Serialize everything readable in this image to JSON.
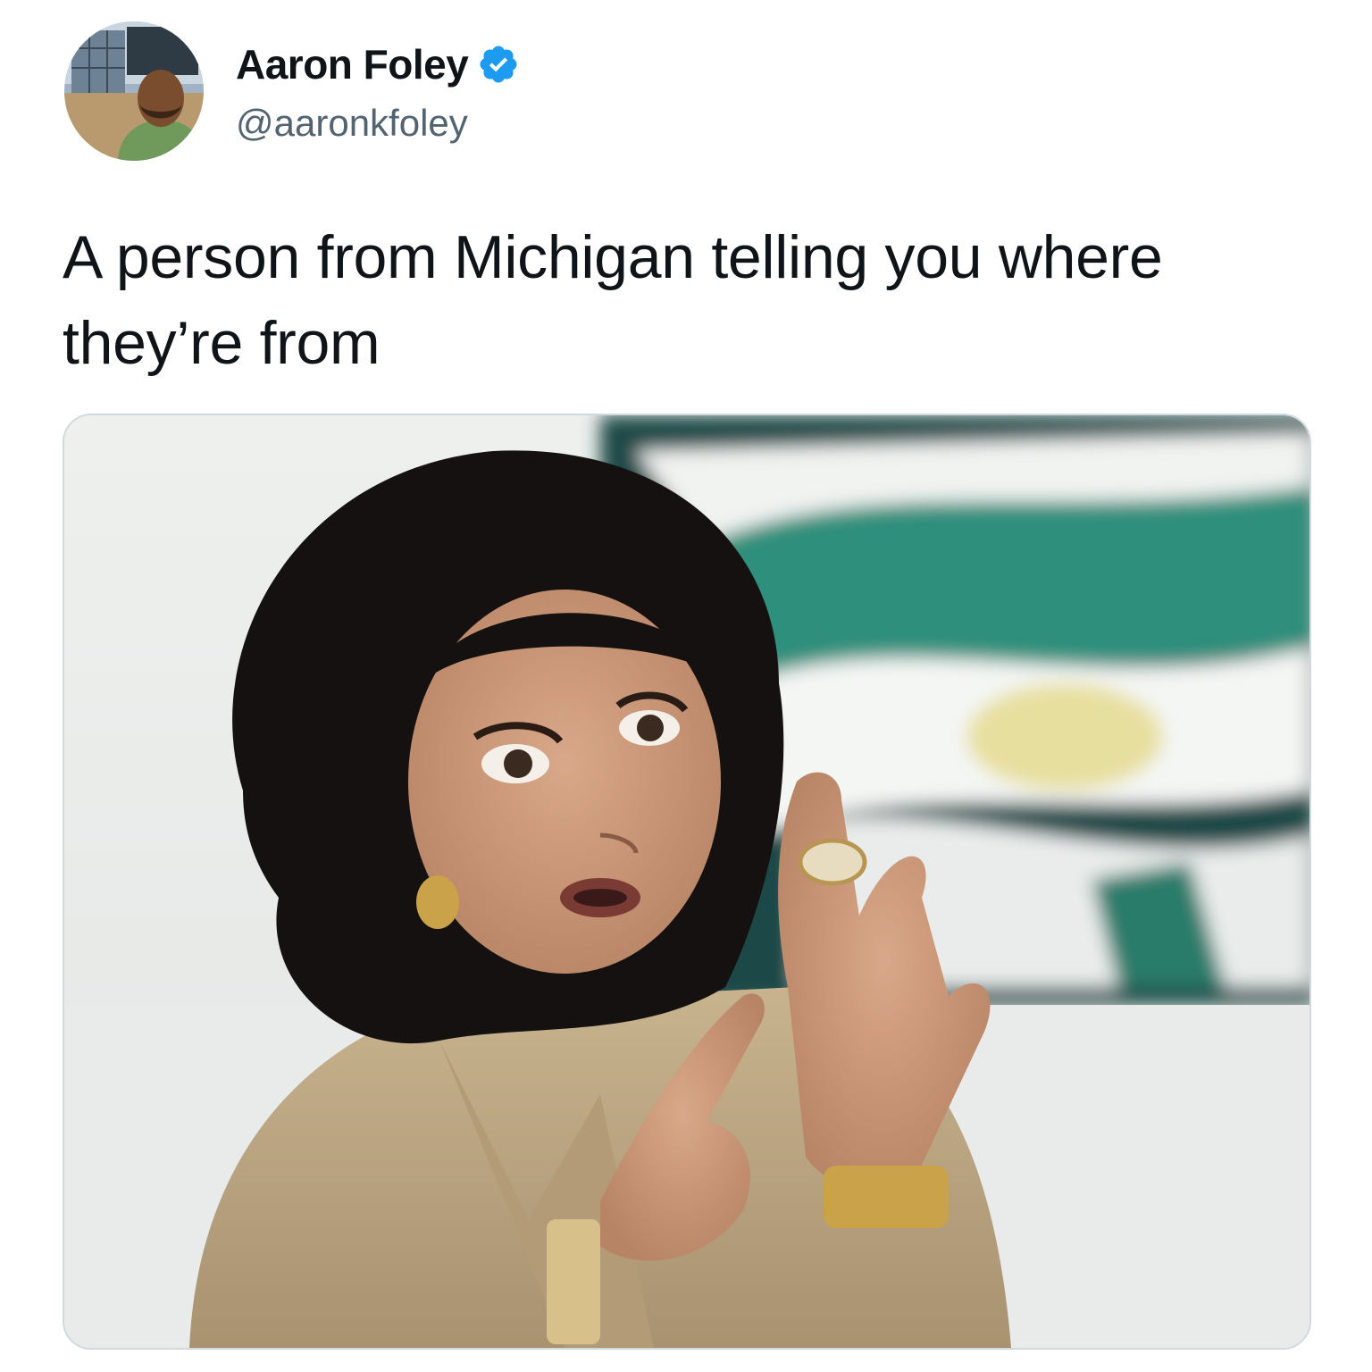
{
  "tweet": {
    "author": {
      "display_name": "Aaron Foley",
      "handle": "@aaronkfoley",
      "verified": true,
      "avatar_icon": "profile-photo"
    },
    "text": "A person from Michigan telling you where they’re from",
    "media": {
      "type": "photo"
    }
  },
  "colors": {
    "text_primary": "#0f1419",
    "text_secondary": "#536471",
    "verified_badge": "#1d9bf0",
    "media_border": "#cfd9de"
  }
}
